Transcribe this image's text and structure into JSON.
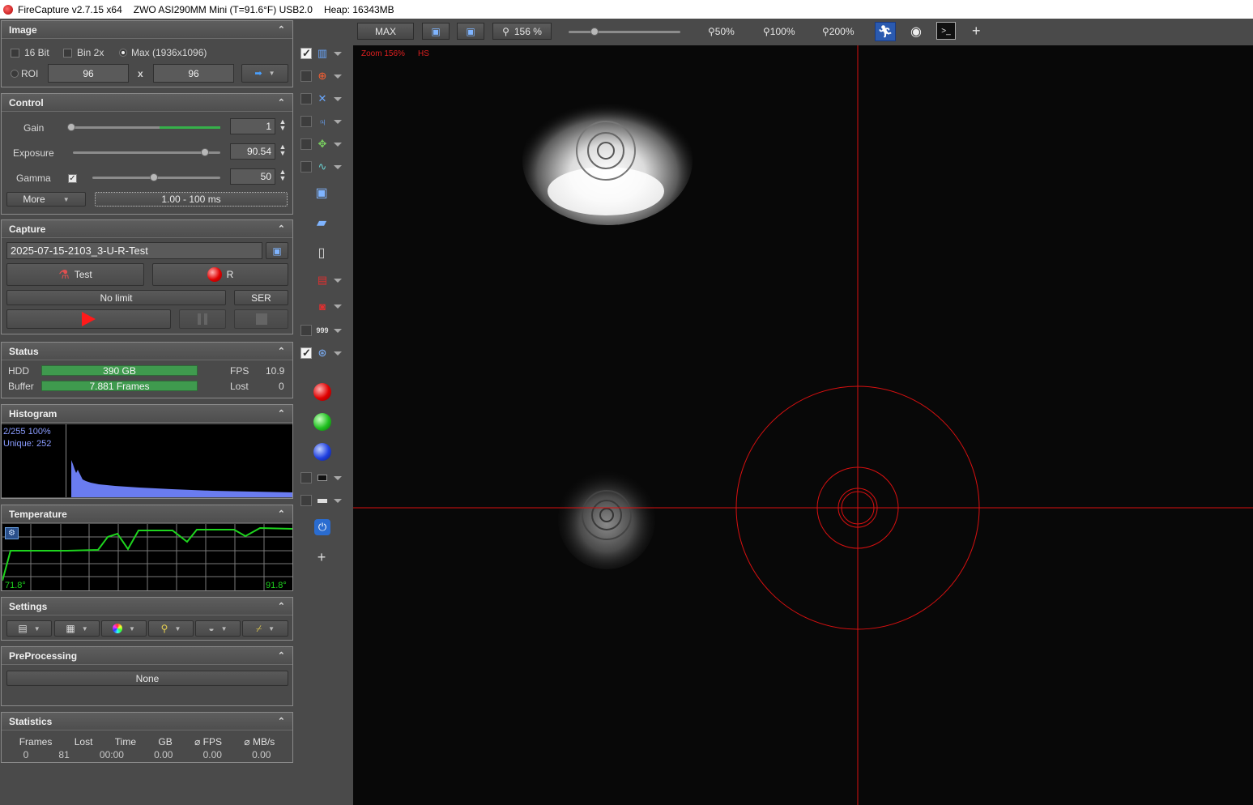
{
  "titlebar": {
    "app": "FireCapture v2.7.15 x64",
    "camera": "ZWO ASI290MM Mini (T=91.6°F) USB2.0",
    "heap": "Heap: 16343MB"
  },
  "image_panel": {
    "title": "Image",
    "bit16": "16 Bit",
    "bin2x": "Bin 2x",
    "max": "Max (1936x1096)",
    "roi": "ROI",
    "roi_w": "96",
    "roi_x": "x",
    "roi_h": "96"
  },
  "control_panel": {
    "title": "Control",
    "gain_label": "Gain",
    "gain_value": "1",
    "exposure_label": "Exposure",
    "exposure_value": "90.54",
    "gamma_label": "Gamma",
    "gamma_value": "50",
    "more_label": "More",
    "range_label": "1.00 - 100 ms"
  },
  "capture_panel": {
    "title": "Capture",
    "filename": "2025-07-15-2103_3-U-R-Test",
    "test_label": "Test",
    "filter_label": "R",
    "limit_label": "No limit",
    "format_label": "SER"
  },
  "status_panel": {
    "title": "Status",
    "hdd_label": "HDD",
    "hdd_value": "390 GB",
    "fps_label": "FPS",
    "fps_value": "10.9",
    "buffer_label": "Buffer",
    "buffer_value": "7.881 Frames",
    "lost_label": "Lost",
    "lost_value": "0"
  },
  "histogram_panel": {
    "title": "Histogram",
    "line1": "2/255 100%",
    "line2": "Unique: 252"
  },
  "temperature_panel": {
    "title": "Temperature",
    "min_label": "71.8°",
    "max_label": "91.8°"
  },
  "settings_panel": {
    "title": "Settings"
  },
  "preprocessing_panel": {
    "title": "PreProcessing",
    "value": "None"
  },
  "statistics_panel": {
    "title": "Statistics",
    "headers": [
      "Frames",
      "Lost",
      "Time",
      "GB",
      "⌀ FPS",
      "⌀ MB/s"
    ],
    "values": [
      "0",
      "81",
      "00:00",
      "0.00",
      "0.00",
      "0.00"
    ]
  },
  "toolbar": {
    "max_label": "MAX",
    "zoom_value": "156 %",
    "zoom50": "50%",
    "zoom100": "100%",
    "zoom200": "200%",
    "plus": "+"
  },
  "viewer": {
    "zoom_text": "Zoom 156%",
    "hs_text": "HS"
  },
  "midbar": {
    "plus": "+"
  },
  "colors": {
    "accent_green": "#3f9a4e",
    "crosshair_red": "#d81010",
    "histogram_blue": "#6a7cf0",
    "temp_green": "#1ed41e"
  }
}
